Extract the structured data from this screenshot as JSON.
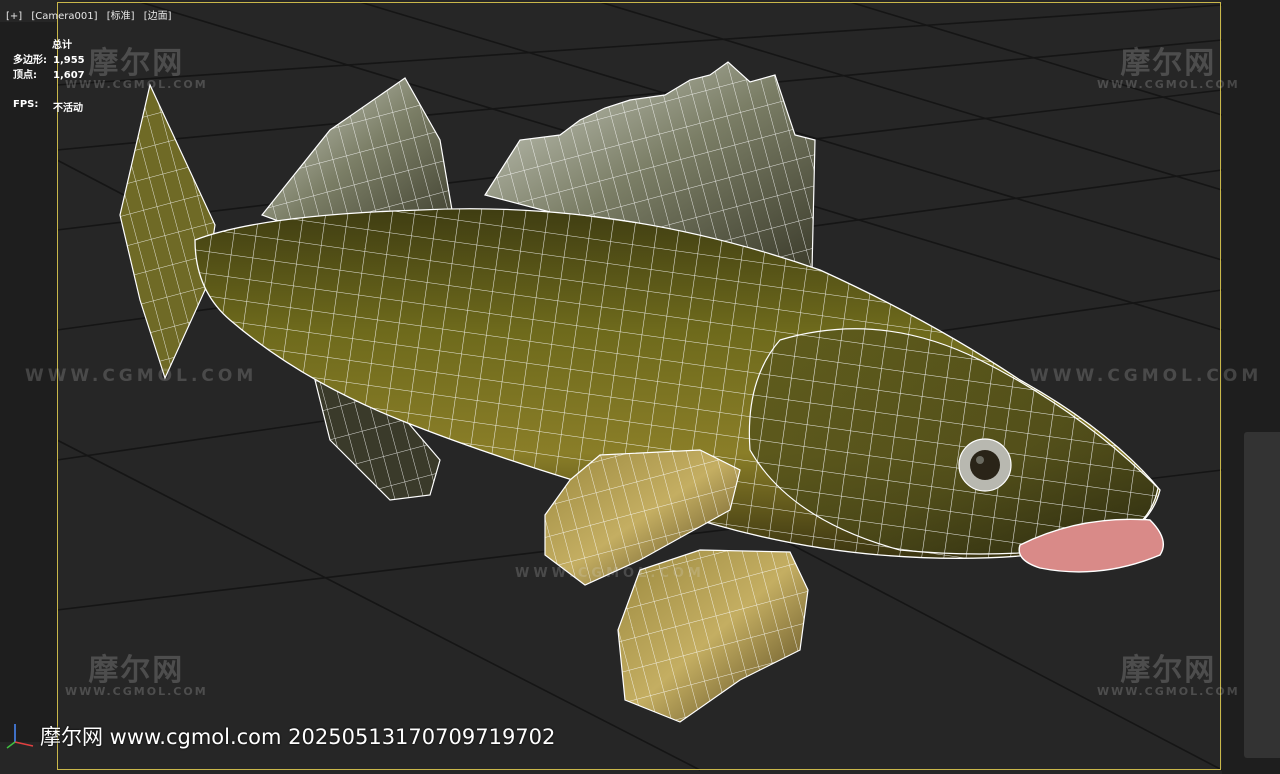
{
  "viewport": {
    "menu": [
      "[+]",
      "[Camera001]",
      "[标准]",
      "[边面]"
    ]
  },
  "stats": {
    "title": "总计",
    "polygons_label": "多边形:",
    "polygons_value": "1,955",
    "vertices_label": "顶点:",
    "vertices_value": "1,607",
    "fps_label": "FPS:",
    "fps_value": "不活动"
  },
  "watermarks": {
    "logo": "摩尔网",
    "logo_url": "WWW.CGMOL.COM",
    "line_text": "WWW.CGMOL.COM"
  },
  "caption": "摩尔网 www.cgmol.com 20250513170709719702",
  "colors": {
    "background": "#262626",
    "frame": "#c9b74a",
    "wire": "#ffffff",
    "fish_body": "#6e6a1c",
    "fish_belly": "#a89a3a",
    "fin": "#8a8a7a",
    "mouth": "#d98a88"
  }
}
